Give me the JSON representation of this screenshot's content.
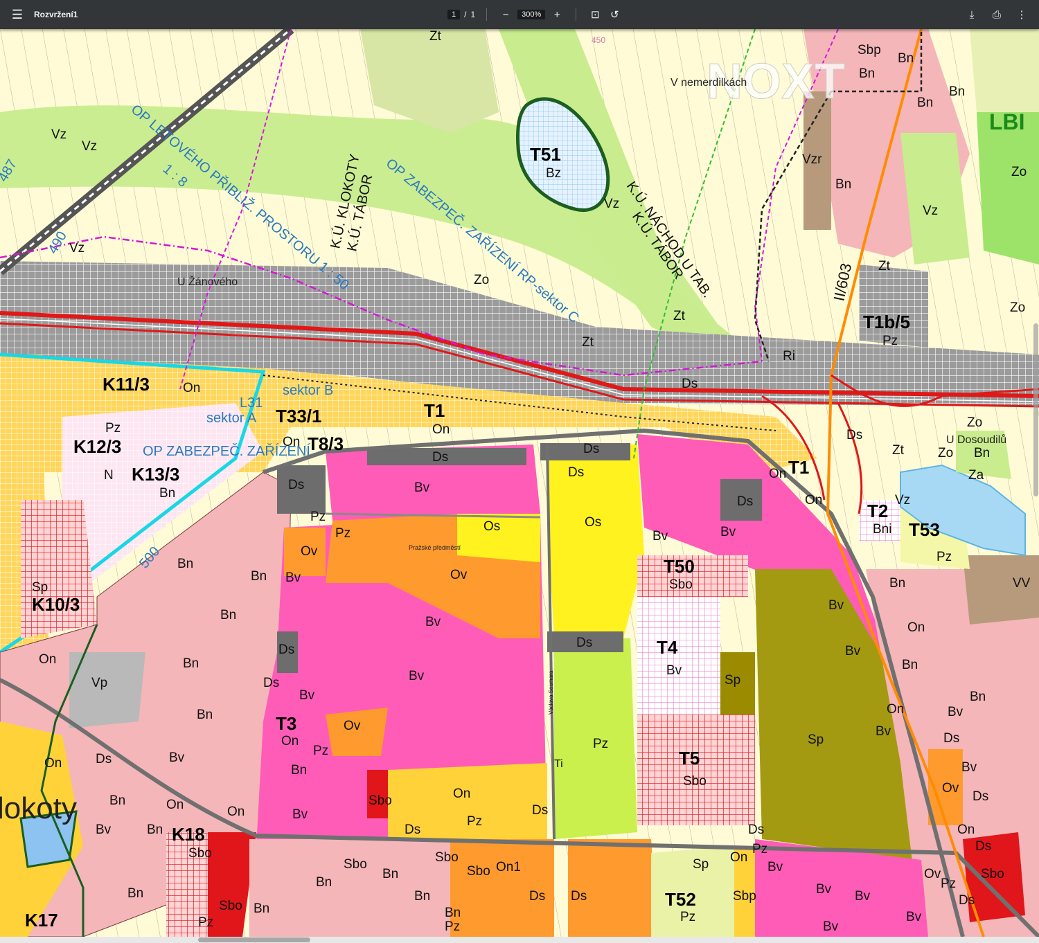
{
  "toolbar": {
    "menu_icon": "menu-icon",
    "title": "Rozvržení1",
    "page_current": "1",
    "page_sep": "/",
    "page_total": "1",
    "zoom_out": "−",
    "zoom_level": "300%",
    "zoom_in": "+",
    "fit_icon": "fit-page-icon",
    "rotate_icon": "rotate-icon",
    "download_icon": "download-icon",
    "print_icon": "print-icon",
    "more_icon": "more-vert-icon"
  },
  "map": {
    "watermark": "NOXT",
    "zones": [
      "T51",
      "T1",
      "T33/1",
      "T8/3",
      "K11/3",
      "K12/3",
      "K13/3",
      "K10/3",
      "T1b/5",
      "T2",
      "T53",
      "T50",
      "T4",
      "T5",
      "T3",
      "K18",
      "K17",
      "T52"
    ],
    "codes": [
      "Zt",
      "Sbp",
      "Bn",
      "Bv",
      "Ds",
      "On",
      "Ov",
      "Os",
      "Pz",
      "Vp",
      "Sp",
      "Sbo",
      "Zo",
      "Vzr",
      "Ri",
      "Vz",
      "Bz",
      "N",
      "VV",
      "Za",
      "Bni",
      "On1",
      "Ti",
      "Zt"
    ],
    "places": [
      "V nemerdilkách",
      "U Žánového",
      "U Dosoudilů",
      "Pražské předměstí",
      "lokoty",
      "LBI"
    ],
    "annotations": [
      "OP LETOVÉHO PŘIBLIŽ. PROSTORU 1 : 50",
      "OP ZABEZPEČ. ZAŘÍZENÍ RP-sektor C",
      "K.Ú. KLOKOTY",
      "K.Ú. TÁBOR",
      "K.Ú. NÁCHOD U TAB.",
      "K.Ú. TÁBOR",
      "II/603",
      "sektor B",
      "sektor A",
      "OP ZABEZPEČ. ZAŘÍZENÍ",
      "450",
      "487",
      "490",
      "500",
      "1 : 8",
      "L31",
      "Václava Soumara"
    ]
  }
}
